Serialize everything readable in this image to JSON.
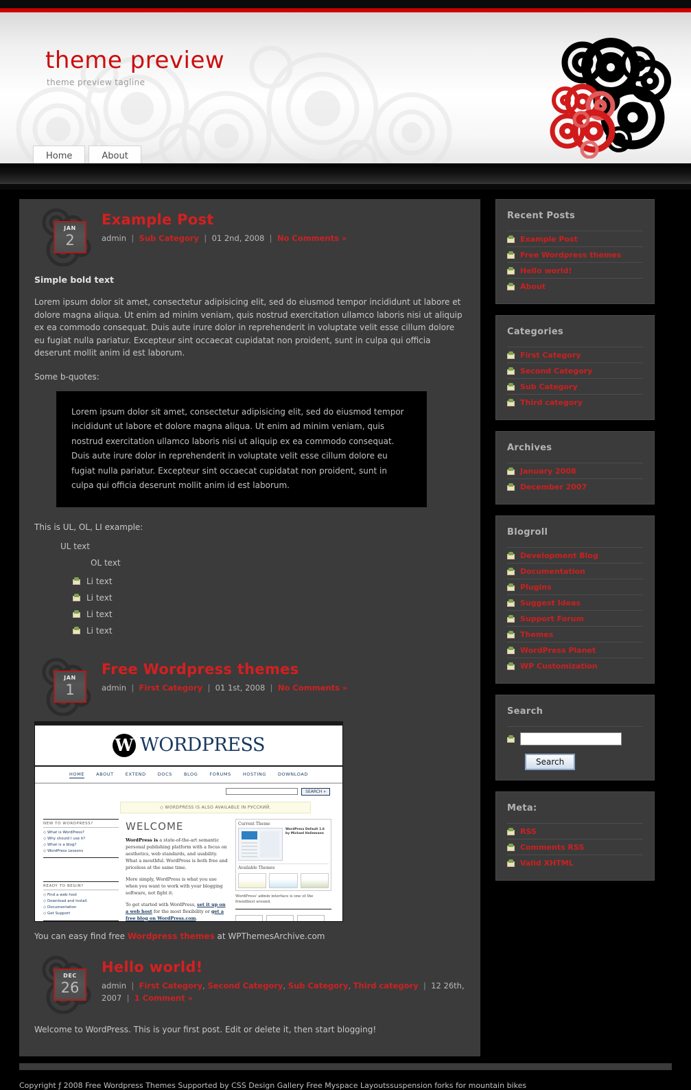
{
  "header": {
    "title": "theme preview",
    "tagline": "theme preview tagline",
    "nav": [
      {
        "label": "Home"
      },
      {
        "label": "About"
      }
    ]
  },
  "posts": [
    {
      "date_month": "JAN",
      "date_day": "2",
      "title": "Example Post",
      "author": "admin",
      "category": "Sub Category",
      "date_text": "01 2nd, 2008",
      "comments": "No Comments »",
      "bold_text": "Simple bold text",
      "paragraph": "Lorem ipsum dolor sit amet, consectetur adipisicing elit, sed do eiusmod tempor incididunt ut labore et dolore magna aliqua. Ut enim ad minim veniam, quis nostrud exercitation ullamco laboris nisi ut aliquip ex ea commodo consequat. Duis aute irure dolor in reprehenderit in voluptate velit esse cillum dolore eu fugiat nulla pariatur. Excepteur sint occaecat cupidatat non proident, sunt in culpa qui officia deserunt mollit anim id est laborum.",
      "bq_label": "Some b-quotes:",
      "blockquote": "Lorem ipsum dolor sit amet, consectetur adipisicing elit, sed do eiusmod tempor incididunt ut labore et dolore magna aliqua. Ut enim ad minim veniam, quis nostrud exercitation ullamco laboris nisi ut aliquip ex ea commodo consequat. Duis aute irure dolor in reprehenderit in voluptate velit esse cillum dolore eu fugiat nulla pariatur. Excepteur sint occaecat cupidatat non proident, sunt in culpa qui officia deserunt mollit anim id est laborum.",
      "list_label": "This is UL, OL, LI example:",
      "ul_text": "UL text",
      "ol_text": "OL text",
      "li_items": [
        "Li text",
        "Li text",
        "Li text",
        "Li text"
      ]
    },
    {
      "date_month": "JAN",
      "date_day": "1",
      "title": "Free Wordpress themes",
      "author": "admin",
      "category": "First Category",
      "date_text": "01 1st, 2008",
      "comments": "No Comments »",
      "caption_pre": "You can easy find free ",
      "caption_link": "Wordpress themes",
      "caption_post": " at WPThemesArchive.com"
    },
    {
      "date_month": "DEC",
      "date_day": "26",
      "title": "Hello world!",
      "author": "admin",
      "categories": [
        "First Category",
        "Second Category",
        "Sub Category",
        "Third category"
      ],
      "date_text": "12 26th, 2007",
      "comments": "1 Comment »",
      "body": "Welcome to WordPress. This is your first post. Edit or delete it, then start blogging!"
    }
  ],
  "wp_screenshot": {
    "logo_text": "ORD",
    "logo_text2": "RESS",
    "nav": [
      "HOME",
      "ABOUT",
      "EXTEND",
      "DOCS",
      "BLOG",
      "FORUMS",
      "HOSTING",
      "DOWNLOAD"
    ],
    "search_button": "SEARCH »",
    "banner": "◇ WORDPRESS IS ALSO AVAILABLE IN РУССКИЙ.",
    "welcome": "WELCOME",
    "col1_h1": "NEW TO WORDPRESS?",
    "col1_items1": [
      "◇ What is WordPress?",
      "◇ Why should I use it?",
      "◇ What is a blog?",
      "◇ WordPress Lessons"
    ],
    "col1_h2": "READY TO BEGIN?",
    "col1_items2": [
      "◇ Find a web host",
      "◇ Download and Install",
      "◇ Documentation",
      "◇ Get Support"
    ],
    "p1_bold": "WordPress is",
    "p1": " a state-of-the-art semantic personal publishing platform with a focus on aesthetics, web standards, and usability. What a mouthful. WordPress is both free and priceless at the same time.",
    "p2": "More simply, WordPress is what you use when you want to work with your blogging software, not fight it.",
    "p3a": "To get started with WordPress, ",
    "p3link1": "set it up on a web host",
    "p3b": " for the most flexibility or ",
    "p3link2": "get a free blog on WordPress.com",
    "p3c": ".",
    "panel_title": "Current Theme",
    "panel_sub": "WordPress Default 1.6 by Michael Heilemann",
    "available": "Available Themes",
    "caption": "WordPress' admin interface is one of the friendliest around."
  },
  "sidebar": {
    "widgets": [
      {
        "title": "Recent Posts",
        "items": [
          "Example Post",
          "Free Wordpress themes",
          "Hello world!",
          "About"
        ]
      },
      {
        "title": "Categories",
        "items": [
          "First Category",
          "Second Category",
          "Sub Category",
          "Third category"
        ]
      },
      {
        "title": "Archives",
        "items": [
          "January 2008",
          "December 2007"
        ]
      },
      {
        "title": "Blogroll",
        "items": [
          "Development Blog",
          "Documentation",
          "Plugins",
          "Suggest Ideas",
          "Support Forum",
          "Themes",
          "WordPress Planet",
          "WP Customization"
        ]
      }
    ],
    "search": {
      "title": "Search",
      "value": "",
      "placeholder": "",
      "button": "Search"
    },
    "meta": {
      "title": "Meta:",
      "items": [
        "RSS",
        "Comments RSS",
        "Valid XHTML"
      ]
    }
  },
  "footer": {
    "text": "Copyright ƒ 2008 Free Wordpress Themes Supported by CSS Design Gallery Free Myspace Layoutssuspension forks for mountain bikes"
  },
  "colors": {
    "accent_red": "#cc2020",
    "title_red": "#d42020",
    "header_red": "#cc0d0d",
    "panel": "#3b3b3b",
    "page_bg": "#000000"
  }
}
